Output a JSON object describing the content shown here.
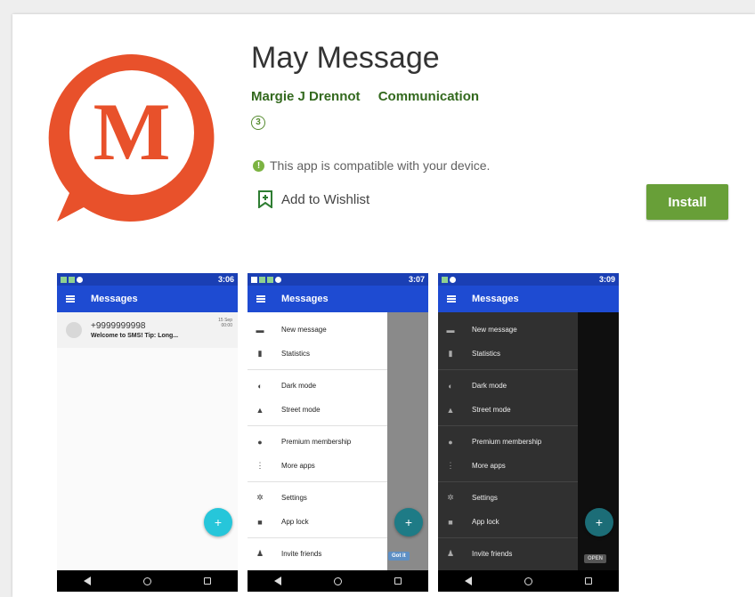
{
  "app": {
    "title": "May Message",
    "developer": "Margie J Drennot",
    "category": "Communication",
    "rating": "3",
    "compat_text": "This app is compatible with your device.",
    "wishlist_label": "Add to Wishlist",
    "install_label": "Install",
    "icon_letter": "M"
  },
  "colors": {
    "brand": "#e8512b",
    "install": "#689f38",
    "appbar": "#1e4bd2",
    "fab": "#26c6da"
  },
  "screenshots": [
    {
      "time": "3:06",
      "appbar_title": "Messages",
      "conversation": {
        "number": "+9999999998",
        "snippet": "Welcome to SMS! Tip: Long...",
        "date": "15 Sep\n00:00"
      }
    },
    {
      "time": "3:07",
      "appbar_title": "Messages",
      "menu": [
        "New message",
        "Statistics",
        "Dark mode",
        "Street mode",
        "Premium membership",
        "More apps",
        "Settings",
        "App lock",
        "Invite friends"
      ],
      "chip": "Got it"
    },
    {
      "time": "3:09",
      "appbar_title": "Messages",
      "menu": [
        "New message",
        "Statistics",
        "Dark mode",
        "Street mode",
        "Premium membership",
        "More apps",
        "Settings",
        "App lock",
        "Invite friends"
      ],
      "chip": "OPEN"
    }
  ]
}
